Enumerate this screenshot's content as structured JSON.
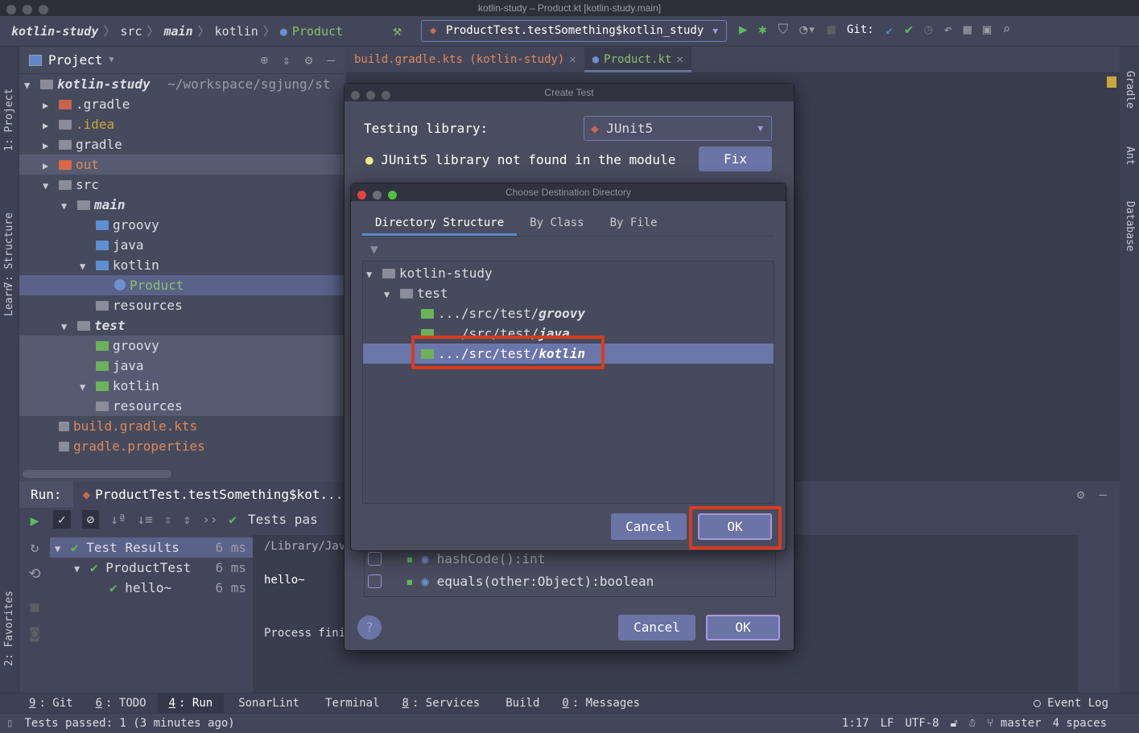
{
  "window": {
    "title": "kotlin-study – Product.kt [kotlin-study.main]"
  },
  "breadcrumb": [
    "kotlin-study",
    "src",
    "main",
    "kotlin",
    "Product"
  ],
  "toolbar": {
    "run_config": "ProductTest.testSomething$kotlin_study",
    "git_label": "Git:"
  },
  "left_strip": [
    "1: Project",
    "7: Structure",
    "Learn",
    "2: Favorites"
  ],
  "right_strip": [
    "Gradle",
    "Ant",
    "Database"
  ],
  "project": {
    "title": "Project",
    "root": {
      "name": "kotlin-study",
      "path": "~/workspace/sgjung/st"
    },
    "items": [
      {
        "name": ".gradle",
        "depth": 1,
        "arrow": "▶",
        "folder": "#c9634e",
        "color": "#dcdde4"
      },
      {
        "name": ".idea",
        "depth": 1,
        "arrow": "▶",
        "folder": "#8a8d99",
        "color": "#c9a73c"
      },
      {
        "name": "gradle",
        "depth": 1,
        "arrow": "▶",
        "folder": "#8a8d99",
        "color": "#dcdde4"
      },
      {
        "name": "out",
        "depth": 1,
        "arrow": "▶",
        "folder": "#d9674a",
        "color": "#e0895a",
        "hl": true
      },
      {
        "name": "src",
        "depth": 1,
        "arrow": "▼",
        "folder": "#8a8d99",
        "color": "#dcdde4"
      },
      {
        "name": "main",
        "depth": 2,
        "arrow": "▼",
        "folder": "#8a8d99",
        "color": "#dcdde4",
        "italic": true
      },
      {
        "name": "groovy",
        "depth": 3,
        "arrow": "",
        "folder": "#5d8fd0",
        "color": "#dcdde4"
      },
      {
        "name": "java",
        "depth": 3,
        "arrow": "",
        "folder": "#5d8fd0",
        "color": "#dcdde4"
      },
      {
        "name": "kotlin",
        "depth": 3,
        "arrow": "▼",
        "folder": "#5d8fd0",
        "color": "#dcdde4"
      },
      {
        "name": "Product",
        "depth": 4,
        "arrow": "",
        "folder": "class",
        "color": "#8fbf6a",
        "sel": true
      },
      {
        "name": "resources",
        "depth": 3,
        "arrow": "",
        "folder": "#8a8d99",
        "color": "#dcdde4"
      },
      {
        "name": "test",
        "depth": 2,
        "arrow": "▼",
        "folder": "#8a8d99",
        "color": "#dcdde4",
        "italic": true
      },
      {
        "name": "groovy",
        "depth": 3,
        "arrow": "",
        "folder": "#6cb25a",
        "color": "#dcdde4",
        "hl": true
      },
      {
        "name": "java",
        "depth": 3,
        "arrow": "",
        "folder": "#6cb25a",
        "color": "#dcdde4",
        "hl": true
      },
      {
        "name": "kotlin",
        "depth": 3,
        "arrow": "▼",
        "folder": "#6cb25a",
        "color": "#dcdde4",
        "hl": true
      },
      {
        "name": "resources",
        "depth": 3,
        "arrow": "",
        "folder": "#8a8d99",
        "color": "#dcdde4",
        "hl": true
      },
      {
        "name": "build.gradle.kts",
        "depth": 1,
        "arrow": "",
        "folder": "file",
        "color": "#e0895a"
      },
      {
        "name": "gradle.properties",
        "depth": 1,
        "arrow": "",
        "folder": "file",
        "color": "#e0895a"
      }
    ]
  },
  "editor_tabs": [
    {
      "label": "build.gradle.kts (kotlin-study)",
      "color": "#e0895a"
    },
    {
      "label": "Product.kt",
      "color": "#8fbf6a",
      "active": true
    }
  ],
  "run": {
    "label": "Run:",
    "config": "ProductTest.testSomething$kot...",
    "status": "Tests pas",
    "results": [
      {
        "name": "Test Results",
        "time": "6 ms"
      },
      {
        "name": "ProductTest",
        "time": "6 ms"
      },
      {
        "name": "hello~",
        "time": "6 ms"
      }
    ],
    "console": [
      "/Library/Jav",
      "hello~",
      "Process fini"
    ]
  },
  "create_test": {
    "title": "Create Test",
    "library_label": "Testing library:",
    "library_value": "JUnit5",
    "warning": "JUnit5 library not found in the module",
    "fix": "Fix",
    "members": [
      "hashCode():int",
      "equals(other:Object):boolean"
    ],
    "help": "?",
    "cancel": "Cancel",
    "ok": "OK"
  },
  "choose_dir": {
    "title": "Choose Destination Directory",
    "tabs": [
      "Directory Structure",
      "By Class",
      "By File"
    ],
    "tree": [
      "kotlin-study",
      "test",
      ".../src/test/",
      "groovy",
      ".../src/test/",
      "java",
      ".../src/test/",
      "kotlin"
    ],
    "cancel": "Cancel",
    "ok": "OK"
  },
  "bottom_tools": [
    {
      "n": "9",
      "l": ": Git"
    },
    {
      "n": "6",
      "l": ": TODO"
    },
    {
      "n": "4",
      "l": ": Run",
      "active": true
    },
    {
      "n": "",
      "l": "SonarLint"
    },
    {
      "n": "",
      "l": "Terminal"
    },
    {
      "n": "8",
      "l": ": Services"
    },
    {
      "n": "",
      "l": "Build"
    },
    {
      "n": "0",
      "l": ": Messages"
    }
  ],
  "event_log": "Event Log",
  "status": {
    "message": "Tests passed: 1 (3 minutes ago)",
    "position": "1:17",
    "line_sep": "LF",
    "encoding": "UTF-8",
    "branch": "master",
    "indent": "4 spaces"
  },
  "colors": {
    "accent": "#6b74a6",
    "highlight_box": "#d83b1e",
    "success": "#5fb95f"
  }
}
